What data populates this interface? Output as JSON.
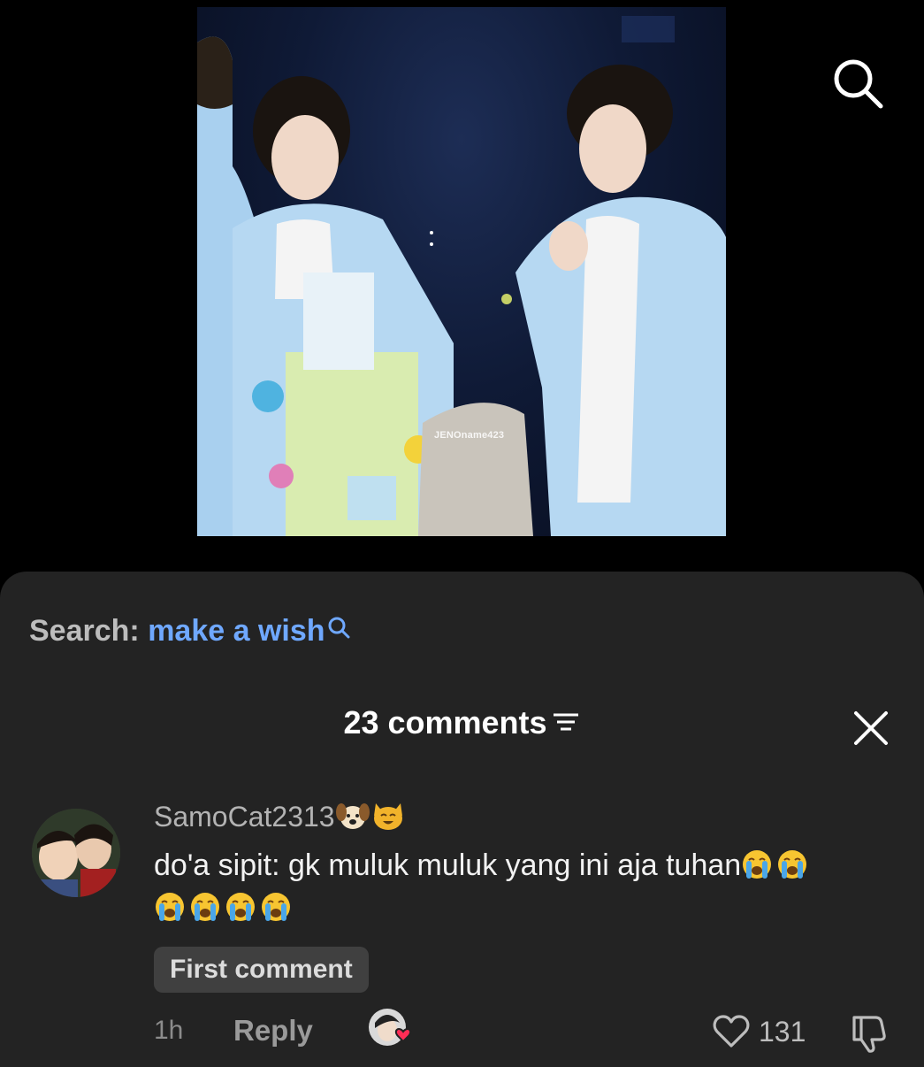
{
  "video": {
    "watermark": "JENOname423"
  },
  "top_bar": {
    "search_icon": "search-icon"
  },
  "comments_sheet": {
    "search": {
      "prefix": "Search:",
      "term": "make a wish",
      "icon": "search-mini-icon"
    },
    "header": {
      "title": "23 comments",
      "sort_icon": "sort-icon",
      "close_icon": "close-icon"
    },
    "comments": [
      {
        "username": "SamoCat2313",
        "username_emojis": [
          "dog-face-emoji",
          "cat-face-emoji"
        ],
        "text": "do'a sipit: gk muluk muluk yang ini aja tuhan",
        "trailing_emoji": "loudly-crying-face-emoji",
        "badge": "First comment",
        "time": "1h",
        "reply_label": "Reply",
        "likes": "131",
        "creator_liked": true
      }
    ]
  },
  "colors": {
    "sheet_bg": "#232323",
    "accent_link": "#6fa8ff",
    "badge_bg": "#404040"
  }
}
